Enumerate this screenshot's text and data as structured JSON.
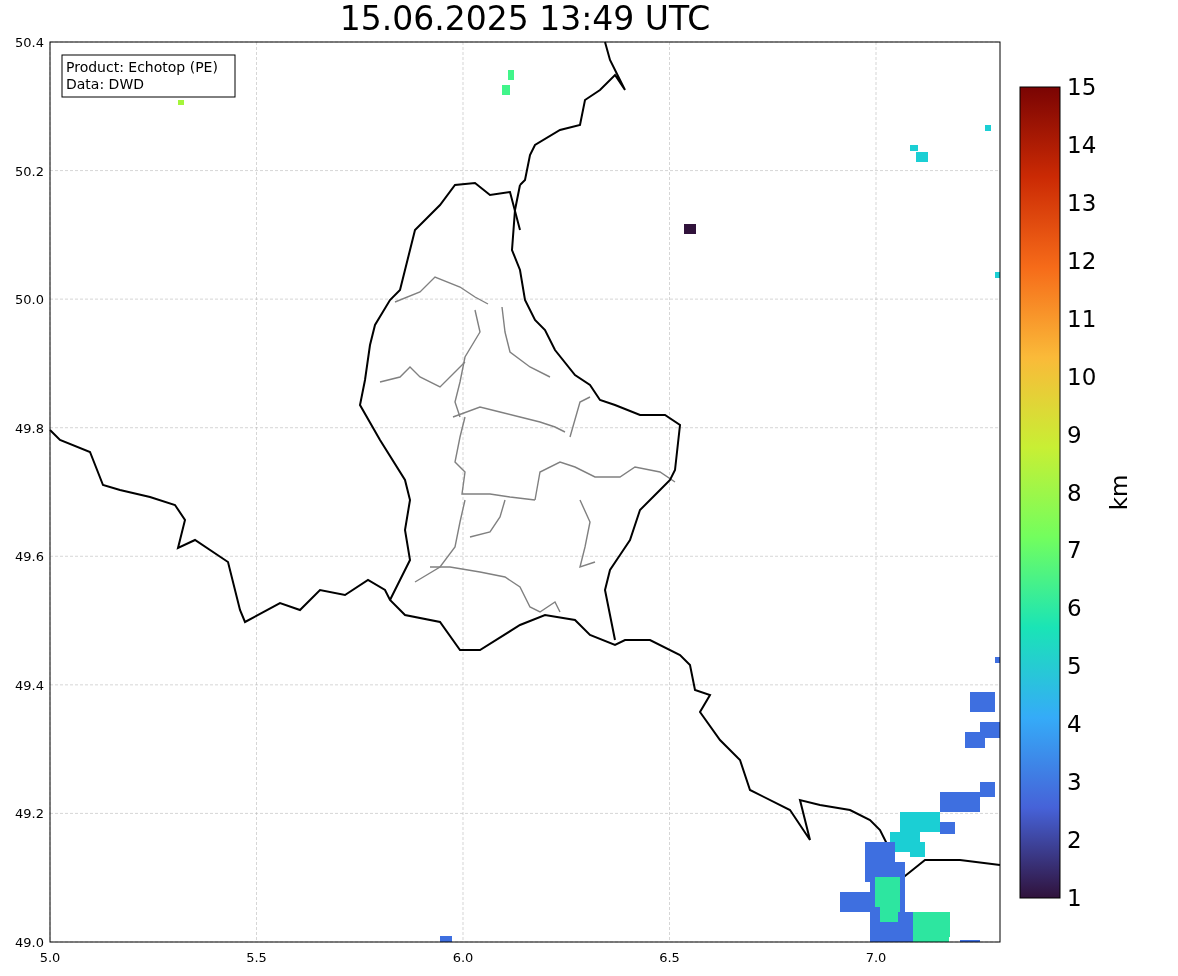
{
  "title": "15.06.2025 13:49 UTC",
  "legend": [
    "Product: Echotop (PE)",
    "Data: DWD"
  ],
  "x_ticks": [
    "5.0",
    "5.5",
    "6.0",
    "6.5",
    "7.0"
  ],
  "y_ticks": [
    "50.4",
    "50.2",
    "50.0",
    "49.8",
    "49.6",
    "49.4",
    "49.2",
    "49.0"
  ],
  "colorbar": {
    "label": "km",
    "ticks": [
      "15",
      "14",
      "13",
      "12",
      "11",
      "10",
      "9",
      "8",
      "7",
      "6",
      "5",
      "4",
      "3",
      "2",
      "1"
    ]
  }
}
